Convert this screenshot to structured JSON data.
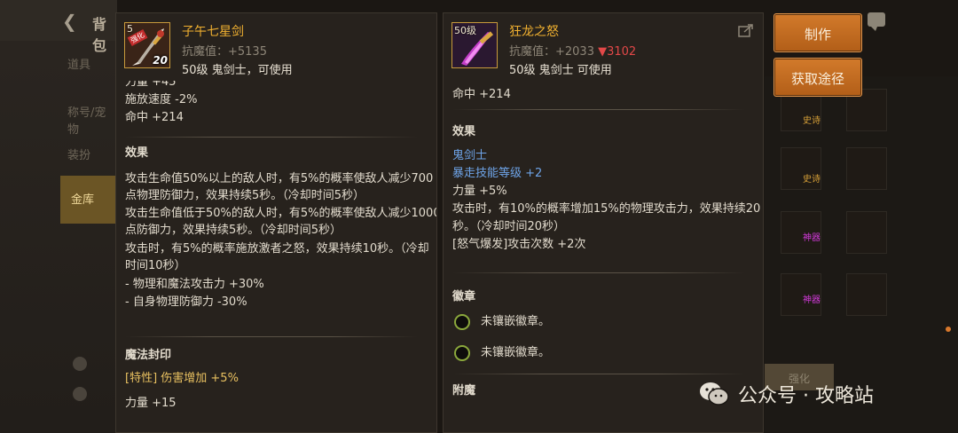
{
  "background": {
    "header_title": "背包",
    "nav_items": [
      "道具",
      "称号/宠物",
      "装扮",
      "金库"
    ],
    "active_nav": "金库",
    "slot_tags": [
      "史诗",
      "史诗",
      "神器",
      "神器"
    ],
    "dim_button": "强化"
  },
  "actions": {
    "make_label": "制作",
    "obtain_label": "获取途径"
  },
  "left_item": {
    "level_tag": "5",
    "ribbon": "强化",
    "badge": "20",
    "name": "子午七星剑",
    "resist_label": "抗魔值：+5135",
    "requirement": "50级 鬼剑士，可使用",
    "stats": [
      "力量 +45",
      "施放速度 -2%",
      "命中 +214"
    ],
    "effect_title": "效果",
    "effect_lines": [
      "攻击生命值50%以上的敌人时，有5%的概率使敌人减少700",
      "点物理防御力，效果持续5秒。（冷却时间5秒）",
      "攻击生命值低于50%的敌人时，有5%的概率使敌人减少1000",
      "点防御力，效果持续5秒。（冷却时间5秒）",
      "攻击时，有5%的概率施放激者之怒，效果持续10秒。（冷却",
      "时间10秒）",
      " - 物理和魔法攻击力 +30%",
      " - 自身物理防御力 -30%"
    ],
    "seal_title": "魔法封印",
    "seal_line": "[特性] 伤害增加 +5%",
    "seal_stat": "力量 +15"
  },
  "right_item": {
    "level_tag": "50级",
    "name": "狂龙之怒",
    "resist_label": "抗魔值：+2033",
    "resist_drop": "▼3102",
    "requirement": "50级 鬼剑士 可使用",
    "stat_top": "命中 +214",
    "effect_title": "效果",
    "class_line": "鬼剑士",
    "skill_line": "暴走技能等级 +2",
    "effect_lines": [
      "力量 +5%",
      "攻击时，有10%的概率增加15%的物理攻击力，效果持续20",
      "秒。（冷却时间20秒）",
      "[怒气爆发]攻击次数 +2次"
    ],
    "emblem_title": "徽章",
    "emblem_slots": [
      "未镶嵌徽章。",
      "未镶嵌徽章。"
    ],
    "enchant_title": "附魔"
  },
  "watermark": {
    "text": "公众号 · 攻略站"
  }
}
